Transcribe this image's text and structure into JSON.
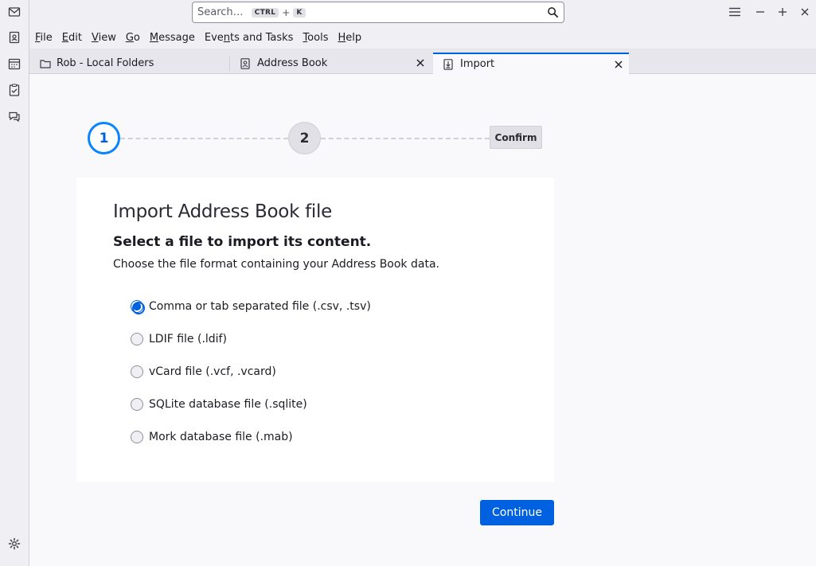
{
  "spaces": {
    "icons": [
      "mail-icon",
      "address-book-icon",
      "calendar-icon",
      "tasks-icon",
      "chat-icon",
      "settings-icon"
    ]
  },
  "titlebar": {
    "search_placeholder": "Search…",
    "shortcut_key1": "CTRL",
    "shortcut_plus": "+",
    "shortcut_key2": "K",
    "menu_glyph": "≡",
    "minimize_glyph": "−",
    "maximize_glyph": "+",
    "close_glyph": "×"
  },
  "menubar": {
    "items": [
      {
        "label": "File",
        "accel": "F"
      },
      {
        "label": "Edit",
        "accel": "E"
      },
      {
        "label": "View",
        "accel": "V"
      },
      {
        "label": "Go",
        "accel": "G"
      },
      {
        "label": "Message",
        "accel": "M"
      },
      {
        "label": "Events and Tasks",
        "accel": "n"
      },
      {
        "label": "Tools",
        "accel": "T"
      },
      {
        "label": "Help",
        "accel": "H"
      }
    ]
  },
  "tabs": [
    {
      "label": "Rob - Local Folders",
      "icon": "folder-icon",
      "closable": false,
      "selected": false
    },
    {
      "label": "Address Book",
      "icon": "address-book-icon",
      "closable": true,
      "selected": false
    },
    {
      "label": "Import",
      "icon": "import-icon",
      "closable": true,
      "selected": true
    }
  ],
  "stepper": {
    "step1": "1",
    "step2": "2",
    "step3": "Confirm"
  },
  "card": {
    "title": "Import Address Book file",
    "subtitle": "Select a file to import its content.",
    "description": "Choose the file format containing your Address Book data.",
    "options": [
      {
        "label": "Comma or tab separated file (.csv, .tsv)",
        "selected": true
      },
      {
        "label": "LDIF file (.ldif)",
        "selected": false
      },
      {
        "label": "vCard file (.vcf, .vcard)",
        "selected": false
      },
      {
        "label": "SQLite database file (.sqlite)",
        "selected": false
      },
      {
        "label": "Mork database file (.mab)",
        "selected": false
      }
    ]
  },
  "continue_label": "Continue",
  "colors": {
    "accent": "#0061e0",
    "step_active_ring": "#0a84ff"
  }
}
